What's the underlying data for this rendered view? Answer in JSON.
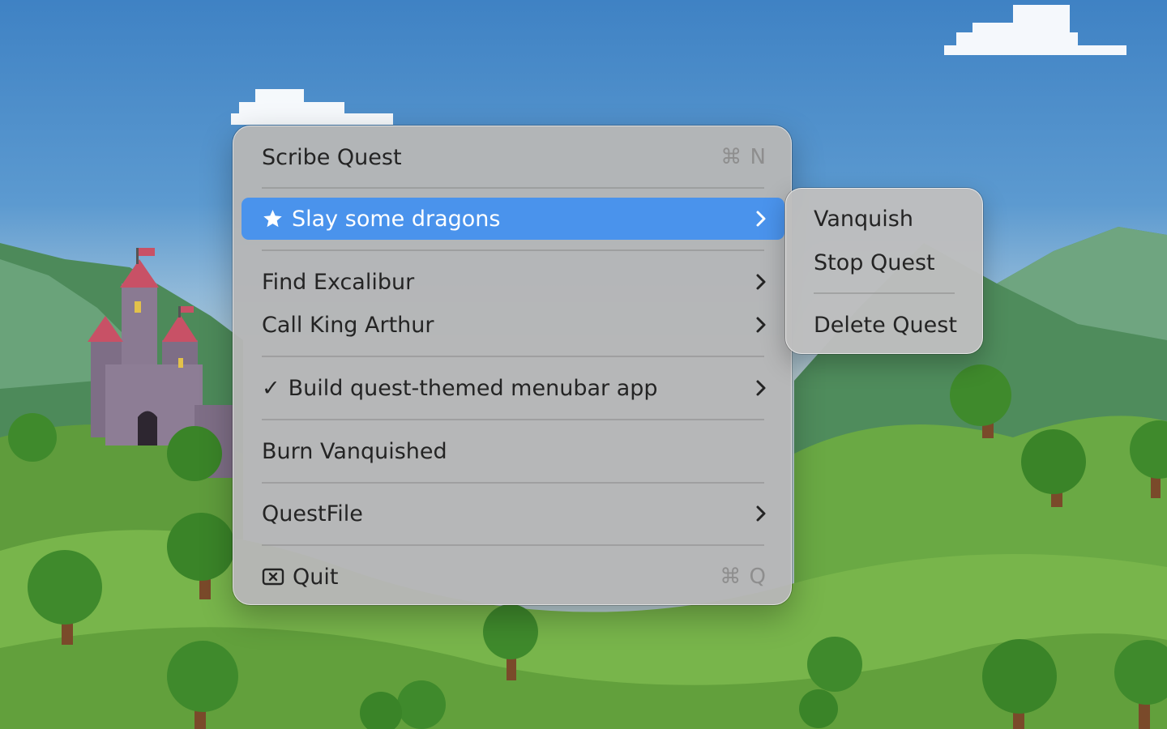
{
  "menu": {
    "items": [
      {
        "label": "Scribe Quest",
        "shortcut": "⌘ N"
      },
      {
        "label": "Slay some dragons",
        "prefix_icon": "star-icon",
        "submenu_icon": "chevron-right-icon",
        "highlighted": true
      },
      {
        "label": "Find Excalibur",
        "submenu_icon": "chevron-right-icon"
      },
      {
        "label": "Call King Arthur",
        "submenu_icon": "chevron-right-icon"
      },
      {
        "label": "Build quest-themed menubar app",
        "prefix_text": "✓",
        "submenu_icon": "chevron-right-icon"
      },
      {
        "label": "Burn Vanquished"
      },
      {
        "label": "QuestFile",
        "submenu_icon": "chevron-right-icon"
      },
      {
        "label": "Quit",
        "prefix_icon": "xmark-square-icon",
        "shortcut": "⌘ Q"
      }
    ]
  },
  "submenu": {
    "items": [
      {
        "label": "Vanquish"
      },
      {
        "label": "Stop Quest"
      },
      {
        "label": "Delete Quest"
      }
    ]
  },
  "colors": {
    "highlight": "#4a93ec",
    "menu_bg": "#b6b6b6",
    "text": "#242424",
    "shortcut_text": "#8e8e8e"
  }
}
